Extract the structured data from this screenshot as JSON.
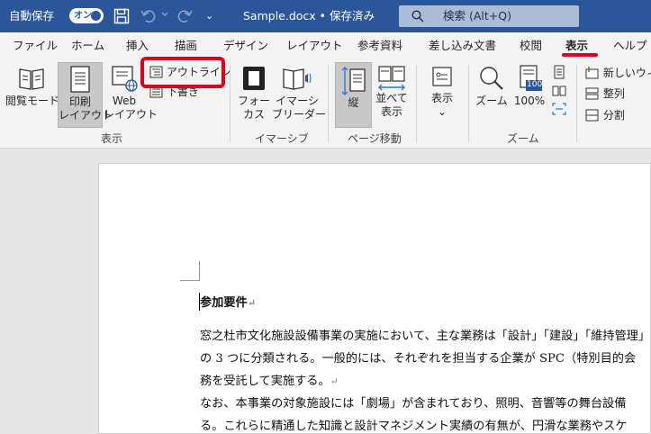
{
  "titlebar": {
    "autosave_label": "自動保存",
    "autosave_toggle": "オン",
    "document_title": "Sample.docx • 保存済み",
    "qat_more": "⌄",
    "search_placeholder": "検索 (Alt+Q)"
  },
  "tabs": [
    {
      "label": "ファイル",
      "active": false
    },
    {
      "label": "ホーム",
      "active": false
    },
    {
      "label": "挿入",
      "active": false
    },
    {
      "label": "描画",
      "active": false
    },
    {
      "label": "デザイン",
      "active": false
    },
    {
      "label": "レイアウト",
      "active": false
    },
    {
      "label": "参考資料",
      "active": false
    },
    {
      "label": "差し込み文書",
      "active": false
    },
    {
      "label": "校閲",
      "active": false
    },
    {
      "label": "表示",
      "active": true
    },
    {
      "label": "ヘルプ",
      "active": false
    }
  ],
  "ribbon": {
    "views": {
      "read_mode": "閲覧モード",
      "print_layout_1": "印刷",
      "print_layout_2": "レイアウト",
      "web_layout_1": "Web",
      "web_layout_2": "レイアウト",
      "outline": "アウトライン",
      "draft": "下書き",
      "group_label": "表示"
    },
    "immersive": {
      "focus_1": "フォー",
      "focus_2": "カス",
      "immersive_reader_1": "イマーシ",
      "immersive_reader_2": "ブリーダー",
      "group_label": "イマーシブ"
    },
    "page_movement": {
      "vertical": "縦",
      "side_by_side_1": "並べて",
      "side_by_side_2": "表示",
      "group_label": "ページ移動"
    },
    "show": {
      "label": "表示",
      "chevron": "⌄"
    },
    "zoom": {
      "zoom": "ズーム",
      "hundred": "100%",
      "hundred_icon_text": "100",
      "group_label": "ズーム"
    },
    "window": {
      "new_window": "新しいウィン",
      "arrange_all": "整列",
      "split": "分割"
    }
  },
  "document": {
    "heading": "参加要件",
    "lines": [
      "窓之杜市文化施設設備事業の実施において、主な業務は「設計」「建設」「維持管理」",
      "の 3 つに分類される。一般的には、それぞれを担当する企業が SPC（特別目的会",
      "務を受託して実施する。",
      "なお、本事業の対象施設には「劇場」が含まれており、照明、音響等の舞台設備",
      "る。これらに精通した知識と設計マネジメント実績の有無が、円滑な業務やスケ"
    ],
    "paragraph_mark": "↵"
  }
}
